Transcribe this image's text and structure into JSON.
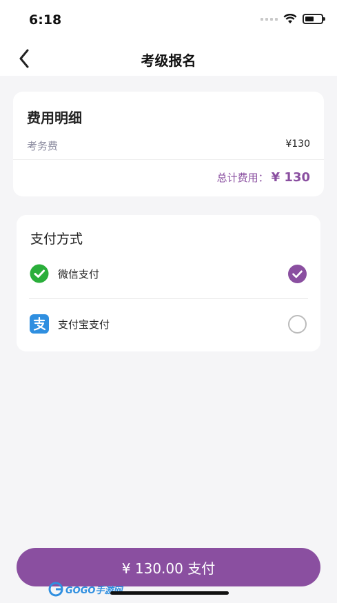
{
  "status_bar": {
    "time": "6:18"
  },
  "nav": {
    "title": "考级报名",
    "back_icon": "chevron-left-icon"
  },
  "fee_detail": {
    "title": "费用明细",
    "items": [
      {
        "name": "考务费",
        "amount": "¥130"
      }
    ],
    "total_label": "总计费用：",
    "total_amount": "¥ 130"
  },
  "payment": {
    "title": "支付方式",
    "methods": [
      {
        "label": "微信支付",
        "icon": "wechat-pay-icon",
        "selected": true
      },
      {
        "label": "支付宝支付",
        "icon": "alipay-icon",
        "selected": false
      }
    ]
  },
  "pay_button": {
    "label": "¥ 130.00  支付"
  },
  "colors": {
    "accent": "#8a4fa0",
    "wechat": "#2aae3a",
    "alipay": "#2f8fe0"
  },
  "watermark": {
    "text": "GOGO手游网"
  }
}
